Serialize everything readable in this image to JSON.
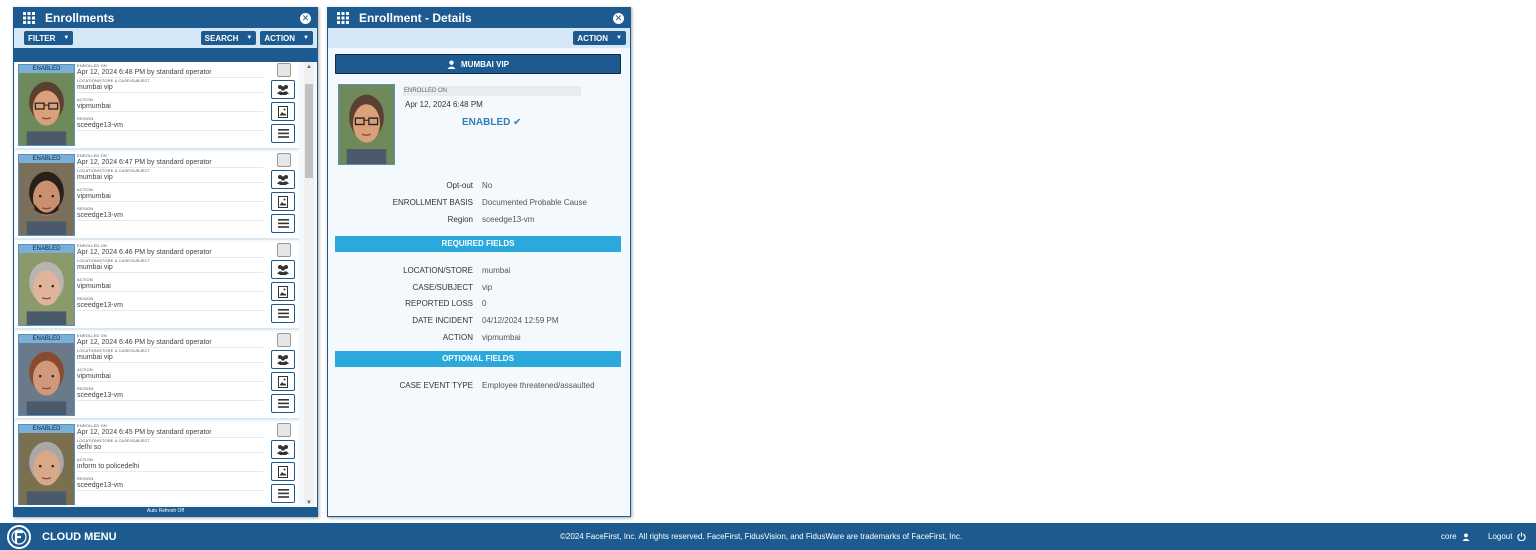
{
  "enrollments_panel": {
    "title": "Enrollments",
    "filter_label": "FILTER",
    "search_label": "SEARCH",
    "action_label": "ACTION",
    "auto_refresh": "Auto Refresh Off",
    "labels": {
      "enrolled_on": "ENROLLED ON",
      "location": "LOCATION/STORE & CASE/SUBJECT",
      "action": "ACTION",
      "region": "REGION"
    },
    "items": [
      {
        "badge": "ENABLED",
        "enrolled_on": "Apr 12, 2024 6:48 PM by standard operator",
        "location": "mumbai vip",
        "action": "vipmumbai",
        "region": "sceedge13-vm"
      },
      {
        "badge": "ENABLED",
        "enrolled_on": "Apr 12, 2024 6:47 PM by standard operator",
        "location": "mumbai vip",
        "action": "vipmumbai",
        "region": "sceedge13-vm"
      },
      {
        "badge": "ENABLED",
        "enrolled_on": "Apr 12, 2024 6:46 PM by standard operator",
        "location": "mumbai vip",
        "action": "vipmumbai",
        "region": "sceedge13-vm"
      },
      {
        "badge": "ENABLED",
        "enrolled_on": "Apr 12, 2024 6:46 PM by standard operator",
        "location": "mumbai vip",
        "action": "vipmumbai",
        "region": "sceedge13-vm"
      },
      {
        "badge": "ENABLED",
        "enrolled_on": "Apr 12, 2024 6:45 PM by standard operator",
        "location": "delhi so",
        "action": "inform to policedelhi",
        "region": "sceedge13-vm"
      }
    ]
  },
  "details_panel": {
    "title": "Enrollment - Details",
    "action_label": "ACTION",
    "name": "MUMBAI VIP",
    "enrolled_on_label": "ENROLLED ON",
    "enrolled_on_value": "Apr 12, 2024 6:48 PM",
    "status": "ENABLED",
    "fields": [
      {
        "key": "Opt-out",
        "value": "No"
      },
      {
        "key": "ENROLLMENT BASIS",
        "value": "Documented Probable Cause"
      },
      {
        "key": "Region",
        "value": "sceedge13-vm"
      }
    ],
    "required_header": "REQUIRED FIELDS",
    "required_fields": [
      {
        "key": "LOCATION/STORE",
        "value": "mumbai"
      },
      {
        "key": "CASE/SUBJECT",
        "value": "vip"
      },
      {
        "key": "REPORTED LOSS",
        "value": "0"
      },
      {
        "key": "DATE INCIDENT",
        "value": "04/12/2024 12:59 PM"
      },
      {
        "key": "ACTION",
        "value": "vipmumbai"
      }
    ],
    "optional_header": "OPTIONAL FIELDS",
    "optional_fields": [
      {
        "key": "CASE EVENT TYPE",
        "value": "Employee threatened/assaulted"
      }
    ]
  },
  "footer": {
    "cloud_menu": "CLOUD MENU",
    "copyright": "©2024 FaceFirst, Inc. All rights reserved. FaceFirst, FidusVision, and FidusWare are trademarks of FaceFirst, Inc.",
    "user": "core",
    "logout": "Logout"
  },
  "colors": {
    "primary": "#1d5a8f",
    "section": "#2ba9dc",
    "toolbar": "#d6e8f7"
  }
}
